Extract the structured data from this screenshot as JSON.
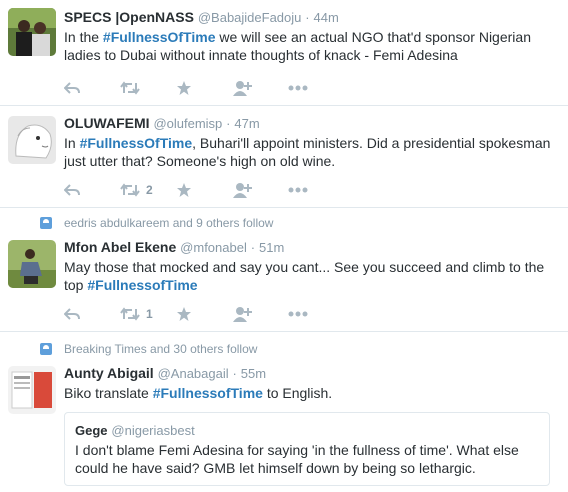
{
  "tweets": [
    {
      "name": "SPECS |OpenNASS",
      "handle": "@BabajideFadoju",
      "time": "44m",
      "pre": "In the ",
      "hashtag": "#FullnessOfTime",
      "post": " we will see an actual NGO that'd sponsor Nigerian ladies to Dubai without innate thoughts of knack - Femi Adesina",
      "retweets": ""
    },
    {
      "name": "OLUWAFEMI",
      "handle": "@olufemisp",
      "time": "47m",
      "pre": "In ",
      "hashtag": "#FullnessOfTime",
      "post": ", Buhari'll appoint ministers. Did a presidential spokesman just utter that? Someone's high on old wine.",
      "retweets": "2"
    },
    {
      "context": "eedris abdulkareem and 9 others follow",
      "name": "Mfon Abel Ekene",
      "handle": "@mfonabel",
      "time": "51m",
      "pre": "May those that mocked and say you cant... See you succeed and climb to the top ",
      "hashtag": "#FullnessofTime",
      "post": "",
      "retweets": "1"
    },
    {
      "context": "Breaking Times and 30 others follow",
      "name": "Aunty Abigail",
      "handle": "@Anabagail",
      "time": "55m",
      "pre": "Biko translate ",
      "hashtag": "#FullnessofTime",
      "post": " to English.",
      "quote": {
        "name": "Gege",
        "handle": "@nigeriasbest",
        "text": "I don't blame Femi Adesina for saying 'in the fullness of time'. What else could he have said? GMB let himself down by being so lethargic."
      }
    }
  ],
  "separator": "·",
  "colors": {
    "hashtag": "#2b7bb9",
    "meta": "#8899a6",
    "icons": "#aab8c2"
  }
}
